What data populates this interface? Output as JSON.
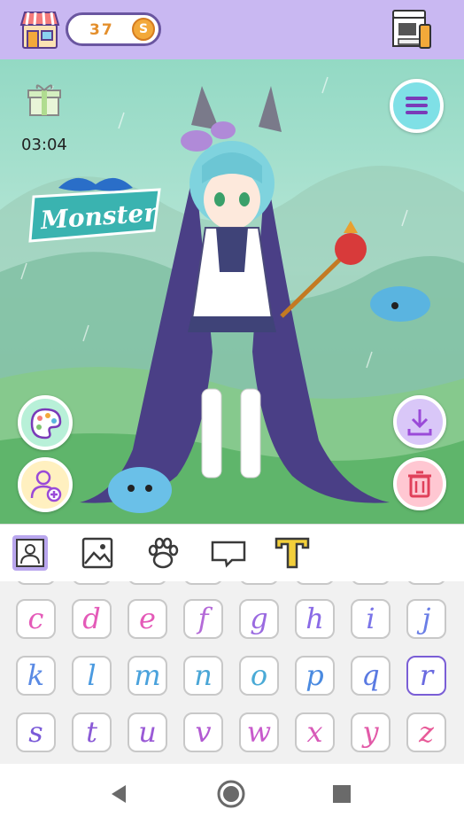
{
  "header": {
    "coins": "37",
    "coin_symbol": "S"
  },
  "scene": {
    "timer": "03:04",
    "logo_text": "Monster"
  },
  "letter_keys": [
    {
      "letter": "c",
      "color": "#e45ab8",
      "selected": false
    },
    {
      "letter": "d",
      "color": "#e45ab8",
      "selected": false
    },
    {
      "letter": "e",
      "color": "#e45ab8",
      "selected": false
    },
    {
      "letter": "f",
      "color": "#b46ad8",
      "selected": false
    },
    {
      "letter": "g",
      "color": "#9a6ae0",
      "selected": false
    },
    {
      "letter": "h",
      "color": "#8a6ae6",
      "selected": false
    },
    {
      "letter": "i",
      "color": "#7a74e8",
      "selected": false
    },
    {
      "letter": "j",
      "color": "#6a7ee6",
      "selected": false
    },
    {
      "letter": "k",
      "color": "#5a8ae4",
      "selected": false
    },
    {
      "letter": "l",
      "color": "#4a9ae0",
      "selected": false
    },
    {
      "letter": "m",
      "color": "#4aa2dc",
      "selected": false
    },
    {
      "letter": "n",
      "color": "#4aa6d6",
      "selected": false
    },
    {
      "letter": "o",
      "color": "#4aaad6",
      "selected": false
    },
    {
      "letter": "p",
      "color": "#4a8ae0",
      "selected": false
    },
    {
      "letter": "q",
      "color": "#5a7ae2",
      "selected": false
    },
    {
      "letter": "r",
      "color": "#6a6ae0",
      "selected": true
    },
    {
      "letter": "s",
      "color": "#7a5ad8",
      "selected": false
    },
    {
      "letter": "t",
      "color": "#8a5ad6",
      "selected": false
    },
    {
      "letter": "u",
      "color": "#9a5ad6",
      "selected": false
    },
    {
      "letter": "v",
      "color": "#b25ad2",
      "selected": false
    },
    {
      "letter": "w",
      "color": "#c85acc",
      "selected": false
    },
    {
      "letter": "x",
      "color": "#d85ab8",
      "selected": false
    },
    {
      "letter": "y",
      "color": "#e25aa8",
      "selected": false
    },
    {
      "letter": "z",
      "color": "#e85a98",
      "selected": false
    }
  ],
  "colors": {
    "topbar": "#c9b8f2",
    "accent": "#7a5ed6",
    "coin": "#f3a93a"
  },
  "icons": [
    "shop-icon",
    "coin-icon",
    "vending-machine-icon",
    "gift-icon",
    "menu-icon",
    "palette-icon",
    "add-person-icon",
    "download-icon",
    "trash-icon",
    "character-tab-icon",
    "background-tab-icon",
    "pet-tab-icon",
    "speech-bubble-tab-icon",
    "text-tab-icon",
    "back-icon",
    "home-icon",
    "recents-icon"
  ]
}
